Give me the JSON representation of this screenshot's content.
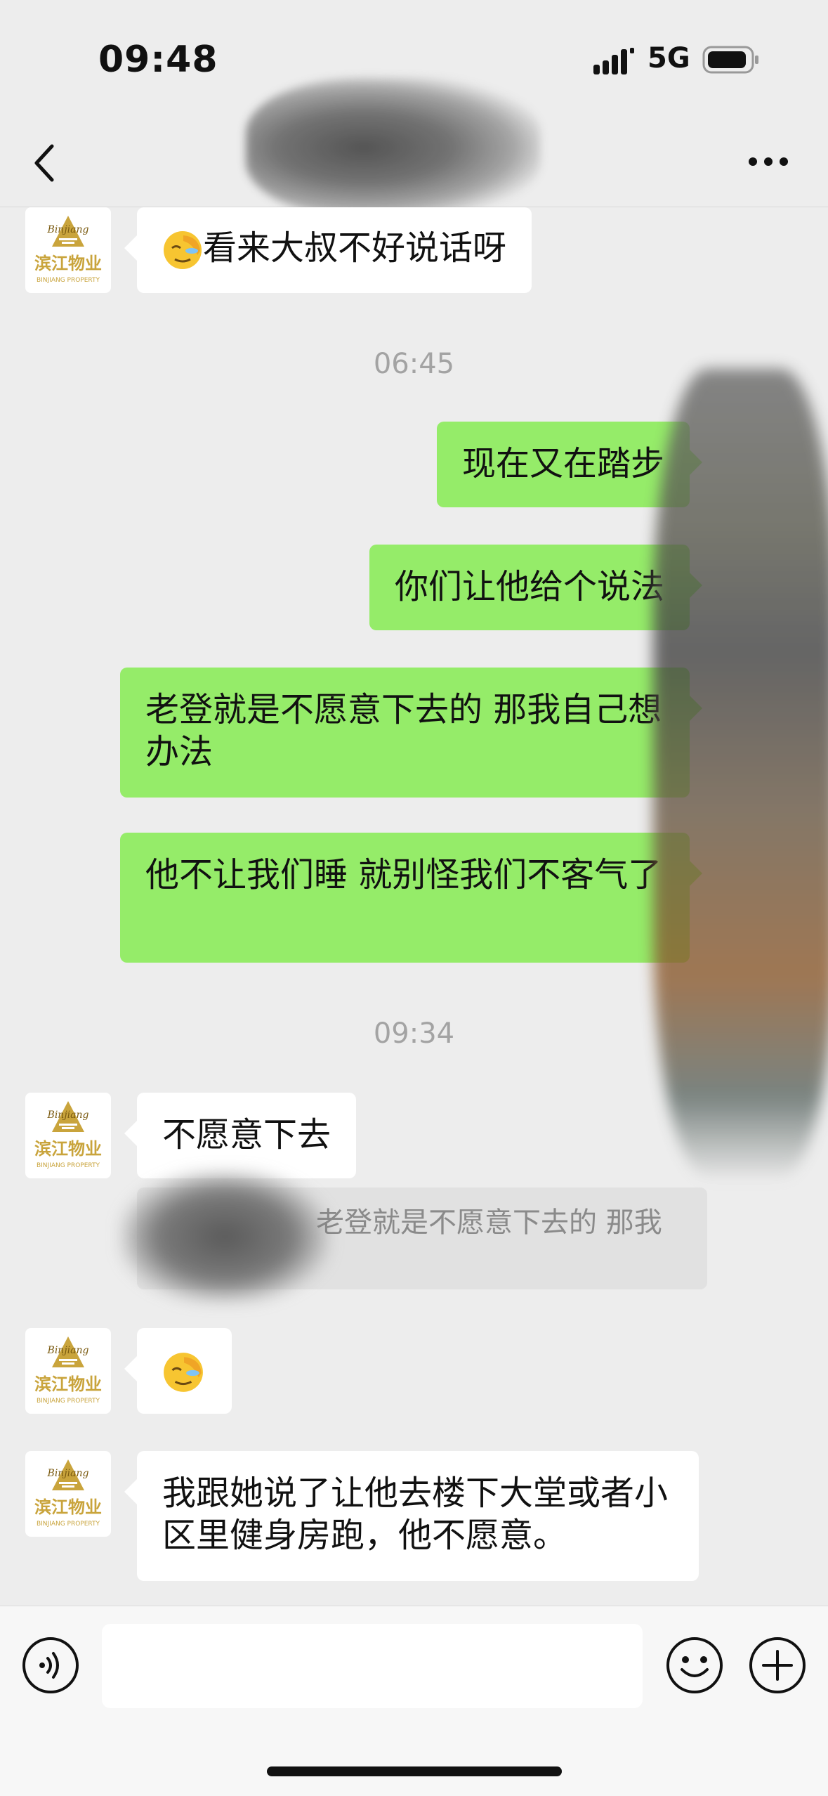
{
  "status_bar": {
    "time": "09:48",
    "network": "5G",
    "signal_icon": "signal-bars-icon",
    "battery_icon": "battery-icon"
  },
  "nav": {
    "back_icon": "chevron-left-icon",
    "more_icon": "more-dots-icon"
  },
  "avatar": {
    "brand_cn": "滨江物业",
    "brand_en": "BINJIANG PROPERTY",
    "script_logo": "Binjiang"
  },
  "messages": {
    "m1": {
      "emoji": "facepalm-emoji",
      "text": "看来大叔不好说话呀"
    },
    "ts1": "06:45",
    "m2": {
      "text": "现在又在踏步"
    },
    "m3": {
      "text": "你们让他给个说法"
    },
    "m4": {
      "text": "老登就是不愿意下去的 那我自己想办法"
    },
    "m5": {
      "text": "他不让我们睡 就别怪我们不客气了"
    },
    "ts2": "09:34",
    "m6": {
      "text": "不愿意下去"
    },
    "quote": {
      "text": "老登就是不愿意下去的 那我"
    },
    "m7": {
      "emoji": "facepalm-emoji"
    },
    "m8": {
      "text": "我跟她说了让他去楼下大堂或者小区里健身房跑，他不愿意。"
    }
  },
  "input_bar": {
    "voice_icon": "voice-icon",
    "emoji_icon": "smiley-icon",
    "plus_icon": "plus-icon",
    "placeholder": ""
  },
  "colors": {
    "background": "#ededed",
    "outgoing_bubble": "#95ec69",
    "incoming_bubble": "#ffffff",
    "brand_gold": "#c9a43c"
  }
}
